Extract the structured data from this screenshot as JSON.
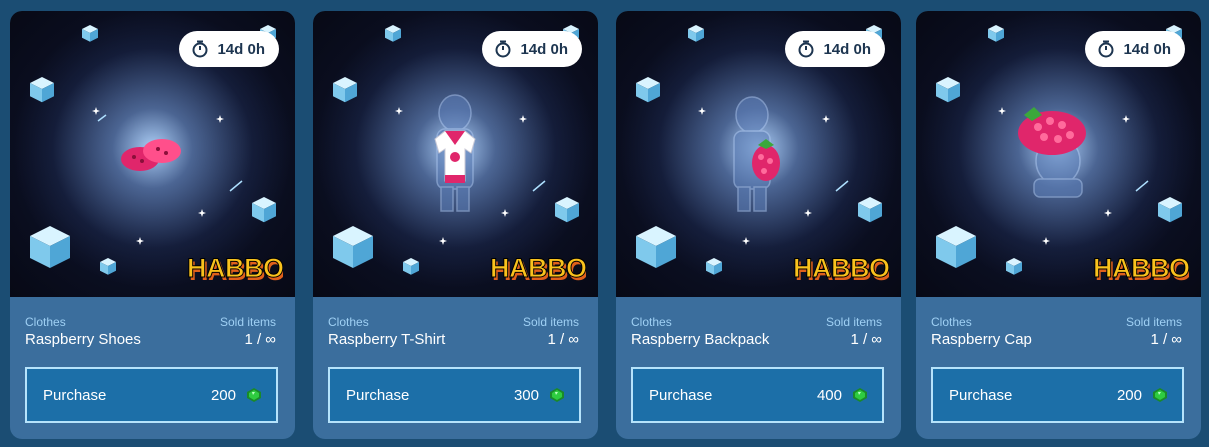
{
  "items": [
    {
      "category": "Clothes",
      "name": "Raspberry Shoes",
      "sold_label": "Sold items",
      "sold": "1 / ∞",
      "timer": "14d 0h",
      "purchase_label": "Purchase",
      "price": "200"
    },
    {
      "category": "Clothes",
      "name": "Raspberry T-Shirt",
      "sold_label": "Sold items",
      "sold": "1 / ∞",
      "timer": "14d 0h",
      "purchase_label": "Purchase",
      "price": "300"
    },
    {
      "category": "Clothes",
      "name": "Raspberry Backpack",
      "sold_label": "Sold items",
      "sold": "1 / ∞",
      "timer": "14d 0h",
      "purchase_label": "Purchase",
      "price": "400"
    },
    {
      "category": "Clothes",
      "name": "Raspberry Cap",
      "sold_label": "Sold items",
      "sold": "1 / ∞",
      "timer": "14d 0h",
      "purchase_label": "Purchase",
      "price": "200"
    }
  ],
  "logo_text": "HABBO",
  "icons": {
    "timer": "stopwatch-icon",
    "currency": "green-gem-icon"
  },
  "colors": {
    "page_bg": "#1b4d73",
    "card_bg": "#3b6e9d",
    "button_bg": "#1c6fa8",
    "button_border": "#b6e3fb",
    "category_text": "#9fd0f4",
    "logo_yellow": "#f9c21d",
    "logo_orange": "#e0601b",
    "gem_green": "#2ecc40",
    "raspberry": "#e0266b"
  }
}
